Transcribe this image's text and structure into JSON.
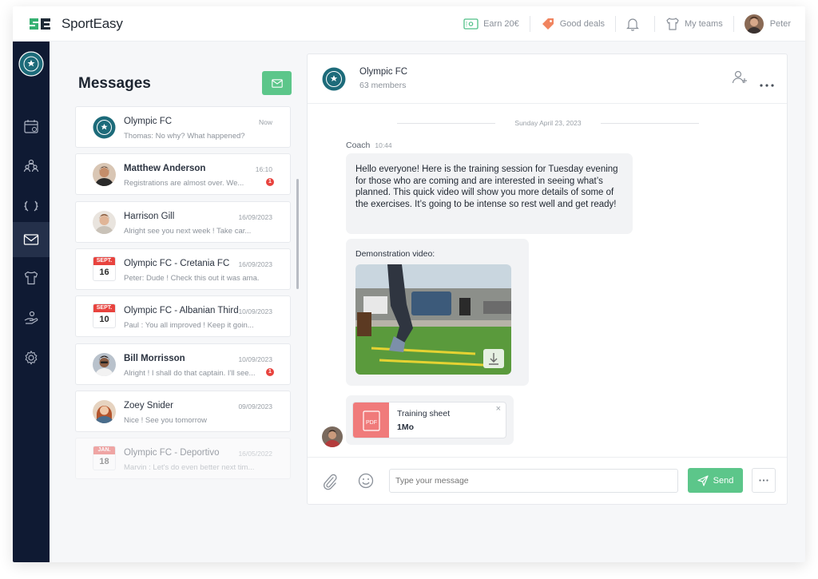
{
  "app": {
    "logo_text": "SportEasy"
  },
  "topbar": {
    "earn_label": "Earn 20€",
    "deals_label": "Good deals",
    "teams_label": "My teams",
    "user_name": "Peter"
  },
  "colors": {
    "accent_green": "#5cc68a",
    "sidebar_bg": "#0f1a33",
    "alert_red": "#e8433e",
    "pdf_red": "#f07b7b"
  },
  "sidebar": {
    "items": [
      {
        "icon": "calendar-icon"
      },
      {
        "icon": "team-members-icon"
      },
      {
        "icon": "trophy-icon"
      },
      {
        "icon": "mail-icon",
        "active": true
      },
      {
        "icon": "jersey-icon"
      },
      {
        "icon": "helping-hand-icon"
      },
      {
        "icon": "gear-icon"
      }
    ]
  },
  "messages": {
    "title": "Messages",
    "conversations": [
      {
        "name": "Olympic FC",
        "preview": "Thomas:  No why? What happened?",
        "date": "Now",
        "bold": false,
        "type": "team"
      },
      {
        "name": "Matthew Anderson",
        "preview": "Registrations are almost over. We...",
        "date": "16:10",
        "bold": true,
        "unread": "1",
        "type": "person"
      },
      {
        "name": "Harrison Gill",
        "preview": "Alright see you next week ! Take car...",
        "date": "16/09/2023",
        "bold": false,
        "type": "person"
      },
      {
        "name": "Olympic FC - Cretania FC",
        "preview": "Peter: Dude ! Check this out it was ama...",
        "date": "16/09/2023",
        "bold": false,
        "type": "event",
        "month": "SEPT.",
        "day": "16"
      },
      {
        "name": "Olympic FC - Albanian Third",
        "preview": "Paul : You all improved ! Keep it goin...",
        "date": "10/09/2023",
        "bold": false,
        "type": "event",
        "month": "SEPT.",
        "day": "10"
      },
      {
        "name": "Bill Morrisson",
        "preview": "Alright ! I shall do that captain. I'll see...",
        "date": "10/09/2023",
        "bold": true,
        "unread": "1",
        "type": "person"
      },
      {
        "name": "Zoey Snider",
        "preview": "Nice ! See you tomorrow",
        "date": "09/09/2023",
        "bold": false,
        "type": "person"
      },
      {
        "name": "Olympic FC - Deportivo",
        "preview": "Marvin :  Let's do even better next tim...",
        "date": "16/05/2022",
        "bold": false,
        "type": "event",
        "month": "JAN.",
        "day": "18"
      }
    ]
  },
  "chat": {
    "team_name": "Olympic FC",
    "members": "63 members",
    "day_separator": "Sunday April 23, 2023",
    "author": "Coach",
    "time": "10:44",
    "message": "Hello everyone! Here is the training session for Tuesday evening for those who are coming and are interested in seeing what’s planned. This quick video will show you more details of some of the exercises. It’s going to be intense so rest well and get ready!",
    "video_label": "Demonstration video:",
    "file_name": "Training sheet",
    "file_size": "1Mo",
    "file_type": "PDF",
    "input_placeholder": "Type your message",
    "send_label": "Send"
  }
}
